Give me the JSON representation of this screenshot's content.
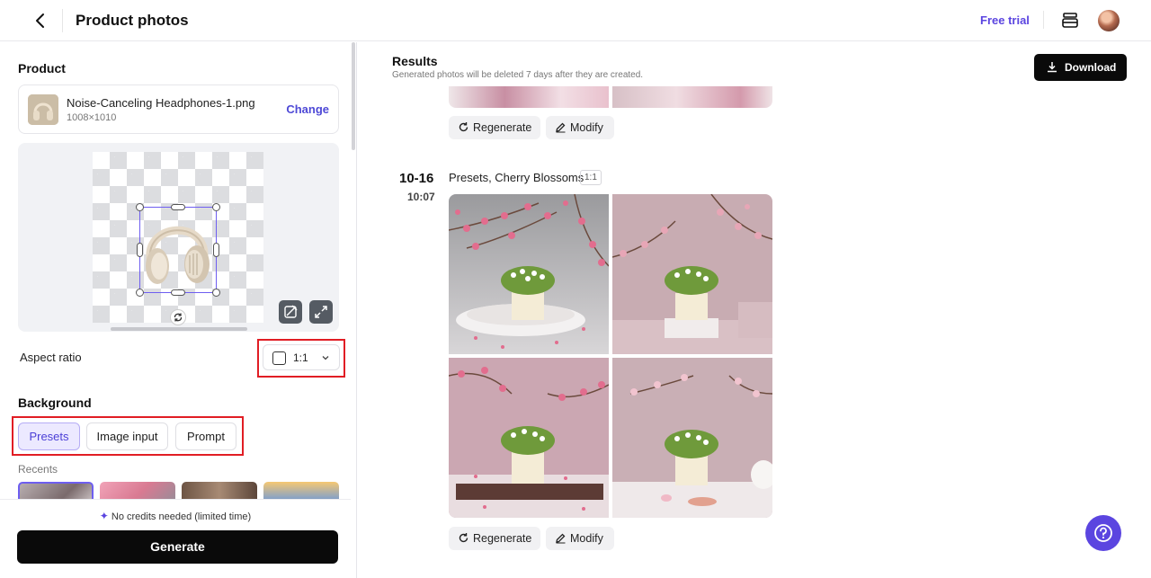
{
  "header": {
    "title": "Product photos",
    "free_trial": "Free trial"
  },
  "product": {
    "section_title": "Product",
    "file_name": "Noise-Canceling Headphones-1.png",
    "dimensions": "1008×1010",
    "change_label": "Change"
  },
  "aspect": {
    "label": "Aspect ratio",
    "value": "1:1"
  },
  "background": {
    "section_title": "Background",
    "tabs": [
      "Presets",
      "Image input",
      "Prompt"
    ],
    "active_tab": "Presets",
    "recents_label": "Recents"
  },
  "generate": {
    "credits_note": "No credits needed (limited time)",
    "button_label": "Generate"
  },
  "results": {
    "title": "Results",
    "subtitle": "Generated photos will be deleted 7 days after they are created.",
    "download_label": "Download",
    "regenerate_label": "Regenerate",
    "modify_label": "Modify",
    "batch": {
      "date": "10-16",
      "time": "10:07",
      "label": "Presets, Cherry Blossoms",
      "ratio": "1:1"
    }
  },
  "colors": {
    "accent": "#5b45e0",
    "highlight_box": "#e11d24",
    "generate_bg": "#0a0a0a"
  },
  "icons": [
    "chevron-left-icon",
    "layers-icon",
    "avatar",
    "rotate-icon",
    "edit-background-icon",
    "expand-icon",
    "chevron-down-icon",
    "sparkle-icon",
    "download-icon",
    "refresh-icon",
    "pencil-icon",
    "help-icon"
  ]
}
